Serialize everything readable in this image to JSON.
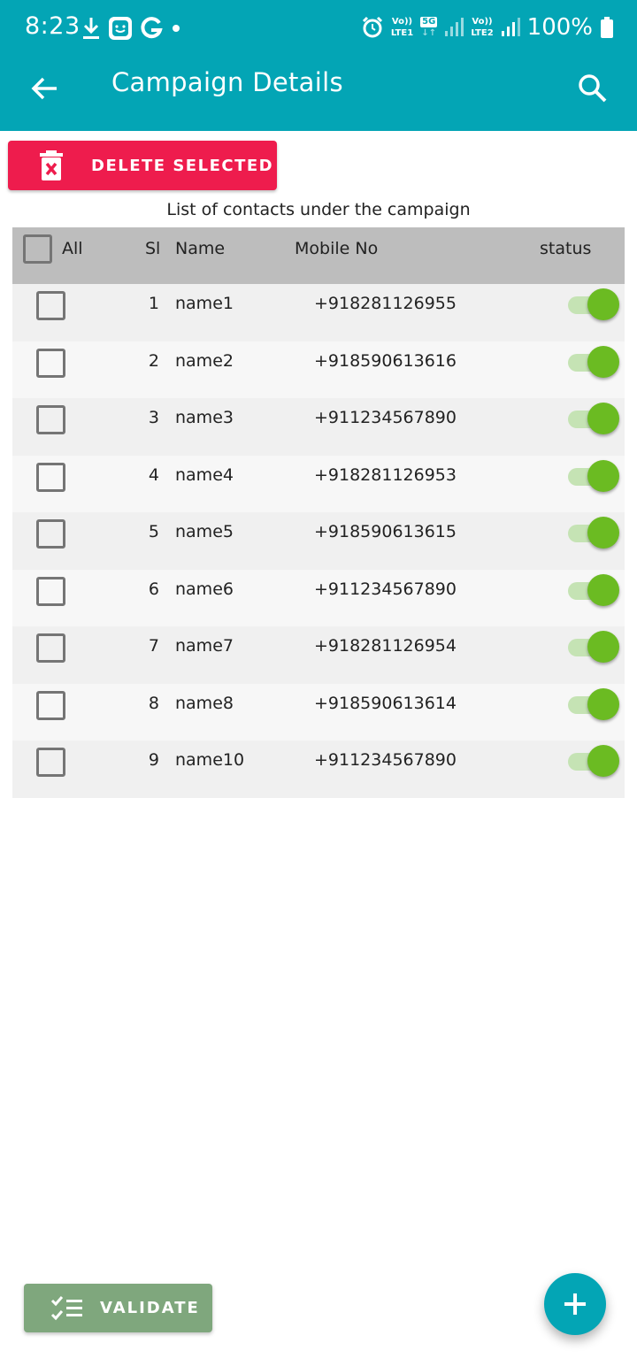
{
  "status_bar": {
    "time": "8:23",
    "battery_percent": "100%",
    "sim1_label_top": "Vo))",
    "sim1_label_bottom": "LTE1",
    "network_5g": "5G",
    "sim2_label_top": "Vo))",
    "sim2_label_bottom": "LTE2",
    "icons": [
      "download-icon",
      "app-face-icon",
      "google-icon",
      "dot-icon",
      "alarm-icon",
      "signal-icon",
      "battery-icon"
    ]
  },
  "app_bar": {
    "title": "Campaign Details",
    "back_icon": "arrow-left-icon",
    "search_icon": "search-icon"
  },
  "actions": {
    "delete_label": "DELETE SELECTED",
    "validate_label": "VALIDATE"
  },
  "caption": "List of contacts under the campaign",
  "table": {
    "headers": {
      "all": "All",
      "sl": "Sl",
      "name": "Name",
      "mobile": "Mobile No",
      "status": "status"
    },
    "rows": [
      {
        "sl": "1",
        "name": "name1",
        "mobile": "+918281126955",
        "checked": false,
        "status_on": true
      },
      {
        "sl": "2",
        "name": "name2",
        "mobile": "+918590613616",
        "checked": false,
        "status_on": true
      },
      {
        "sl": "3",
        "name": "name3",
        "mobile": "+911234567890",
        "checked": false,
        "status_on": true
      },
      {
        "sl": "4",
        "name": "name4",
        "mobile": "+918281126953",
        "checked": false,
        "status_on": true
      },
      {
        "sl": "5",
        "name": "name5",
        "mobile": "+918590613615",
        "checked": false,
        "status_on": true
      },
      {
        "sl": "6",
        "name": "name6",
        "mobile": "+911234567890",
        "checked": false,
        "status_on": true
      },
      {
        "sl": "7",
        "name": "name7",
        "mobile": "+918281126954",
        "checked": false,
        "status_on": true
      },
      {
        "sl": "8",
        "name": "name8",
        "mobile": "+918590613614",
        "checked": false,
        "status_on": true
      },
      {
        "sl": "9",
        "name": "name10",
        "mobile": "+911234567890",
        "checked": false,
        "status_on": true
      }
    ]
  },
  "colors": {
    "primary": "#03a5b5",
    "delete": "#ee1c4d",
    "validate": "#7fa77d",
    "toggle_on": "#6bbb22",
    "header_bg": "#bdbdbd"
  }
}
